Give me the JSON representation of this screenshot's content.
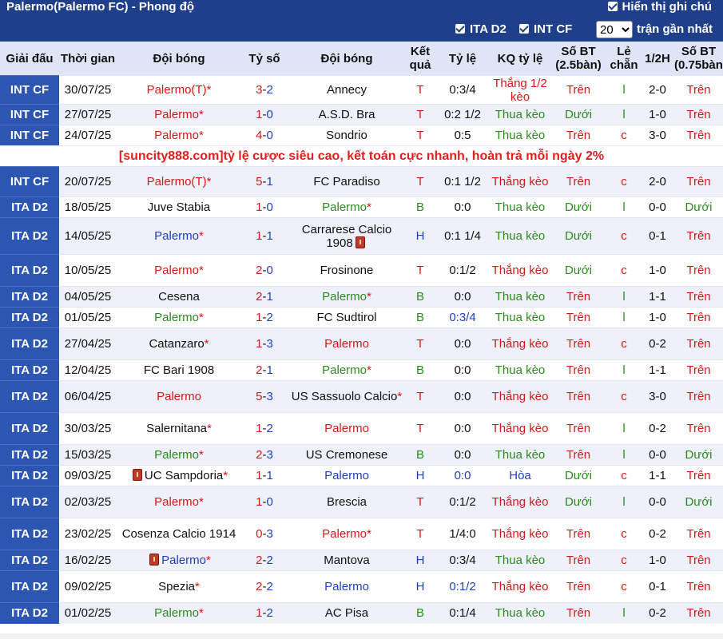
{
  "header": {
    "title": "Palermo(Palermo FC) - Phong độ",
    "show_handicap_note": "Hiển thị ghi chú"
  },
  "filters": {
    "ita_d2": "ITA D2",
    "int_cf": "INT CF",
    "count_selected": "20",
    "recent_label": "trận gần nhất"
  },
  "columns": {
    "league": "Giải đấu",
    "time": "Thời gian",
    "home": "Đội bóng",
    "score": "Tỷ số",
    "away": "Đội bóng",
    "result": "Kết quả",
    "odds": "Tỷ lệ",
    "odds_result": "KQ tỷ lệ",
    "total": "Số BT (2.5bàn)",
    "odd_even": "Lẻ chẵn",
    "half": "1/2H",
    "total2": "Số BT (0.75bàn)"
  },
  "ad_text": "[suncity888.com]tỷ lệ cược siêu cao, kết toán cực nhanh, hoàn trả mỗi ngày 2%",
  "rows": [
    {
      "league": "INT CF",
      "date": "30/07/25",
      "home": "Palermo(T)",
      "home_star": "*",
      "home_color": "red",
      "s1": "3",
      "s2": "2",
      "away": "Annecy",
      "away_star": "",
      "away_color": "black",
      "res": "T",
      "res_color": "red",
      "odds": "0:3/4",
      "odds_color": "black",
      "kq": "Thắng 1/2 kèo",
      "kq_color": "red",
      "bt": "Trên",
      "bt_color": "red",
      "le": "l",
      "le_color": "green",
      "half": "2-0",
      "bt2": "Trên",
      "bt2_color": "red",
      "h": 36
    },
    {
      "league": "INT CF",
      "date": "27/07/25",
      "home": "Palermo",
      "home_star": "*",
      "home_color": "red",
      "s1": "1",
      "s2": "0",
      "away": "A.S.D. Bra",
      "away_star": "",
      "away_color": "black",
      "res": "T",
      "res_color": "red",
      "odds": "0:2 1/2",
      "odds_color": "black",
      "kq": "Thua kèo",
      "kq_color": "green",
      "bt": "Dưới",
      "bt_color": "green",
      "le": "l",
      "le_color": "green",
      "half": "1-0",
      "bt2": "Trên",
      "bt2_color": "red",
      "h": 26
    },
    {
      "league": "INT CF",
      "date": "24/07/25",
      "home": "Palermo",
      "home_star": "*",
      "home_color": "red",
      "s1": "4",
      "s2": "0",
      "away": "Sondrio",
      "away_star": "",
      "away_color": "black",
      "res": "T",
      "res_color": "red",
      "odds": "0:5",
      "odds_color": "black",
      "kq": "Thua kèo",
      "kq_color": "green",
      "bt": "Trên",
      "bt_color": "red",
      "le": "c",
      "le_color": "red",
      "half": "3-0",
      "bt2": "Trên",
      "bt2_color": "red",
      "h": 26
    },
    {
      "ad": true,
      "h": 26
    },
    {
      "league": "INT CF",
      "date": "20/07/25",
      "home": "Palermo(T)",
      "home_star": "*",
      "home_color": "red",
      "s1": "5",
      "s2": "1",
      "away": "FC Paradiso",
      "away_star": "",
      "away_color": "black",
      "res": "T",
      "res_color": "red",
      "odds": "0:1 1/2",
      "odds_color": "black",
      "kq": "Thắng kèo",
      "kq_color": "red",
      "bt": "Trên",
      "bt_color": "red",
      "le": "c",
      "le_color": "red",
      "half": "2-0",
      "bt2": "Trên",
      "bt2_color": "red",
      "h": 38
    },
    {
      "league": "ITA D2",
      "date": "18/05/25",
      "home": "Juve Stabia",
      "home_star": "",
      "home_color": "black",
      "s1": "1",
      "s2": "0",
      "away": "Palermo",
      "away_star": "*",
      "away_color": "green",
      "res": "B",
      "res_color": "green",
      "odds": "0:0",
      "odds_color": "black",
      "kq": "Thua kèo",
      "kq_color": "green",
      "bt": "Dưới",
      "bt_color": "green",
      "le": "l",
      "le_color": "green",
      "half": "0-0",
      "bt2": "Dưới",
      "bt2_color": "green",
      "h": 26
    },
    {
      "league": "ITA D2",
      "date": "14/05/25",
      "home": "Palermo",
      "home_star": "*",
      "home_color": "blue",
      "s1": "1",
      "s2": "1",
      "away": "Carrarese Calcio 1908",
      "away_star": "",
      "away_color": "black",
      "away_card": true,
      "res": "H",
      "res_color": "blue",
      "odds": "0:1 1/4",
      "odds_color": "black",
      "kq": "Thua kèo",
      "kq_color": "green",
      "bt": "Dưới",
      "bt_color": "green",
      "le": "c",
      "le_color": "red",
      "half": "0-1",
      "bt2": "Trên",
      "bt2_color": "red",
      "h": 46
    },
    {
      "league": "ITA D2",
      "date": "10/05/25",
      "home": "Palermo",
      "home_star": "*",
      "home_color": "red",
      "s1": "2",
      "s2": "0",
      "away": "Frosinone",
      "away_star": "",
      "away_color": "black",
      "res": "T",
      "res_color": "red",
      "odds": "0:1/2",
      "odds_color": "black",
      "kq": "Thắng kèo",
      "kq_color": "red",
      "bt": "Dưới",
      "bt_color": "green",
      "le": "c",
      "le_color": "red",
      "half": "1-0",
      "bt2": "Trên",
      "bt2_color": "red",
      "h": 40
    },
    {
      "league": "ITA D2",
      "date": "04/05/25",
      "home": "Cesena",
      "home_star": "",
      "home_color": "black",
      "s1": "2",
      "s2": "1",
      "away": "Palermo",
      "away_star": "*",
      "away_color": "green",
      "res": "B",
      "res_color": "green",
      "odds": "0:0",
      "odds_color": "black",
      "kq": "Thua kèo",
      "kq_color": "green",
      "bt": "Trên",
      "bt_color": "red",
      "le": "l",
      "le_color": "green",
      "half": "1-1",
      "bt2": "Trên",
      "bt2_color": "red",
      "h": 26
    },
    {
      "league": "ITA D2",
      "date": "01/05/25",
      "home": "Palermo",
      "home_star": "*",
      "home_color": "green",
      "s1": "1",
      "s2": "2",
      "away": "FC Sudtirol",
      "away_star": "",
      "away_color": "black",
      "res": "B",
      "res_color": "green",
      "odds": "0:3/4",
      "odds_color": "blue",
      "kq": "Thua kèo",
      "kq_color": "green",
      "bt": "Trên",
      "bt_color": "red",
      "le": "l",
      "le_color": "green",
      "half": "1-0",
      "bt2": "Trên",
      "bt2_color": "red",
      "h": 26
    },
    {
      "league": "ITA D2",
      "date": "27/04/25",
      "home": "Catanzaro",
      "home_star": "*",
      "home_color": "black",
      "s1": "1",
      "s2": "3",
      "away": "Palermo",
      "away_star": "",
      "away_color": "red",
      "res": "T",
      "res_color": "red",
      "odds": "0:0",
      "odds_color": "black",
      "kq": "Thắng kèo",
      "kq_color": "red",
      "bt": "Trên",
      "bt_color": "red",
      "le": "c",
      "le_color": "red",
      "half": "0-2",
      "bt2": "Trên",
      "bt2_color": "red",
      "h": 40
    },
    {
      "league": "ITA D2",
      "date": "12/04/25",
      "home": "FC Bari 1908",
      "home_star": "",
      "home_color": "black",
      "s1": "2",
      "s2": "1",
      "away": "Palermo",
      "away_star": "*",
      "away_color": "green",
      "res": "B",
      "res_color": "green",
      "odds": "0:0",
      "odds_color": "black",
      "kq": "Thua kèo",
      "kq_color": "green",
      "bt": "Trên",
      "bt_color": "red",
      "le": "l",
      "le_color": "green",
      "half": "1-1",
      "bt2": "Trên",
      "bt2_color": "red",
      "h": 26
    },
    {
      "league": "ITA D2",
      "date": "06/04/25",
      "home": "Palermo",
      "home_star": "",
      "home_color": "red",
      "s1": "5",
      "s2": "3",
      "away": "US Sassuolo Calcio",
      "away_star": "*",
      "away_color": "black",
      "res": "T",
      "res_color": "red",
      "odds": "0:0",
      "odds_color": "black",
      "kq": "Thắng kèo",
      "kq_color": "red",
      "bt": "Trên",
      "bt_color": "red",
      "le": "c",
      "le_color": "red",
      "half": "3-0",
      "bt2": "Trên",
      "bt2_color": "red",
      "h": 40
    },
    {
      "league": "ITA D2",
      "date": "30/03/25",
      "home": "Salernitana",
      "home_star": "*",
      "home_color": "black",
      "s1": "1",
      "s2": "2",
      "away": "Palermo",
      "away_star": "",
      "away_color": "red",
      "res": "T",
      "res_color": "red",
      "odds": "0:0",
      "odds_color": "black",
      "kq": "Thắng kèo",
      "kq_color": "red",
      "bt": "Trên",
      "bt_color": "red",
      "le": "l",
      "le_color": "green",
      "half": "0-2",
      "bt2": "Trên",
      "bt2_color": "red",
      "h": 40
    },
    {
      "league": "ITA D2",
      "date": "15/03/25",
      "home": "Palermo",
      "home_star": "*",
      "home_color": "green",
      "s1": "2",
      "s2": "3",
      "away": "US Cremonese",
      "away_star": "",
      "away_color": "black",
      "res": "B",
      "res_color": "green",
      "odds": "0:0",
      "odds_color": "black",
      "kq": "Thua kèo",
      "kq_color": "green",
      "bt": "Trên",
      "bt_color": "red",
      "le": "l",
      "le_color": "green",
      "half": "0-0",
      "bt2": "Dưới",
      "bt2_color": "green",
      "h": 26
    },
    {
      "league": "ITA D2",
      "date": "09/03/25",
      "home": "UC Sampdoria",
      "home_star": "*",
      "home_color": "black",
      "home_card": true,
      "s1": "1",
      "s2": "1",
      "away": "Palermo",
      "away_star": "",
      "away_color": "blue",
      "res": "H",
      "res_color": "blue",
      "odds": "0:0",
      "odds_color": "blue",
      "kq": "Hòa",
      "kq_color": "blue",
      "bt": "Dưới",
      "bt_color": "green",
      "le": "c",
      "le_color": "red",
      "half": "1-1",
      "bt2": "Trên",
      "bt2_color": "red",
      "h": 26
    },
    {
      "league": "ITA D2",
      "date": "02/03/25",
      "home": "Palermo",
      "home_star": "*",
      "home_color": "red",
      "s1": "1",
      "s2": "0",
      "away": "Brescia",
      "away_star": "",
      "away_color": "black",
      "res": "T",
      "res_color": "red",
      "odds": "0:1/2",
      "odds_color": "black",
      "kq": "Thắng kèo",
      "kq_color": "red",
      "bt": "Dưới",
      "bt_color": "green",
      "le": "l",
      "le_color": "green",
      "half": "0-0",
      "bt2": "Dưới",
      "bt2_color": "green",
      "h": 40
    },
    {
      "league": "ITA D2",
      "date": "23/02/25",
      "home": "Cosenza Calcio 1914",
      "home_star": "",
      "home_color": "black",
      "s1": "0",
      "s2": "3",
      "away": "Palermo",
      "away_star": "*",
      "away_color": "red",
      "res": "T",
      "res_color": "red",
      "odds": "1/4:0",
      "odds_color": "black",
      "kq": "Thắng kèo",
      "kq_color": "red",
      "bt": "Trên",
      "bt_color": "red",
      "le": "c",
      "le_color": "red",
      "half": "0-2",
      "bt2": "Trên",
      "bt2_color": "red",
      "h": 40
    },
    {
      "league": "ITA D2",
      "date": "16/02/25",
      "home": "Palermo",
      "home_star": "*",
      "home_color": "blue",
      "home_card": true,
      "s1": "2",
      "s2": "2",
      "away": "Mantova",
      "away_star": "",
      "away_color": "black",
      "res": "H",
      "res_color": "blue",
      "odds": "0:3/4",
      "odds_color": "black",
      "kq": "Thua kèo",
      "kq_color": "green",
      "bt": "Trên",
      "bt_color": "red",
      "le": "c",
      "le_color": "red",
      "half": "1-0",
      "bt2": "Trên",
      "bt2_color": "red",
      "h": 26
    },
    {
      "league": "ITA D2",
      "date": "09/02/25",
      "home": "Spezia",
      "home_star": "*",
      "home_color": "black",
      "s1": "2",
      "s2": "2",
      "away": "Palermo",
      "away_star": "",
      "away_color": "blue",
      "res": "H",
      "res_color": "blue",
      "odds": "0:1/2",
      "odds_color": "blue",
      "kq": "Thắng kèo",
      "kq_color": "red",
      "bt": "Trên",
      "bt_color": "red",
      "le": "c",
      "le_color": "red",
      "half": "0-1",
      "bt2": "Trên",
      "bt2_color": "red",
      "h": 40
    },
    {
      "league": "ITA D2",
      "date": "01/02/25",
      "home": "Palermo",
      "home_star": "*",
      "home_color": "green",
      "s1": "1",
      "s2": "2",
      "away": "AC Pisa",
      "away_star": "",
      "away_color": "black",
      "res": "B",
      "res_color": "green",
      "odds": "0:1/4",
      "odds_color": "black",
      "kq": "Thua kèo",
      "kq_color": "green",
      "bt": "Trên",
      "bt_color": "red",
      "le": "l",
      "le_color": "green",
      "half": "0-2",
      "bt2": "Trên",
      "bt2_color": "red",
      "h": 26
    }
  ]
}
